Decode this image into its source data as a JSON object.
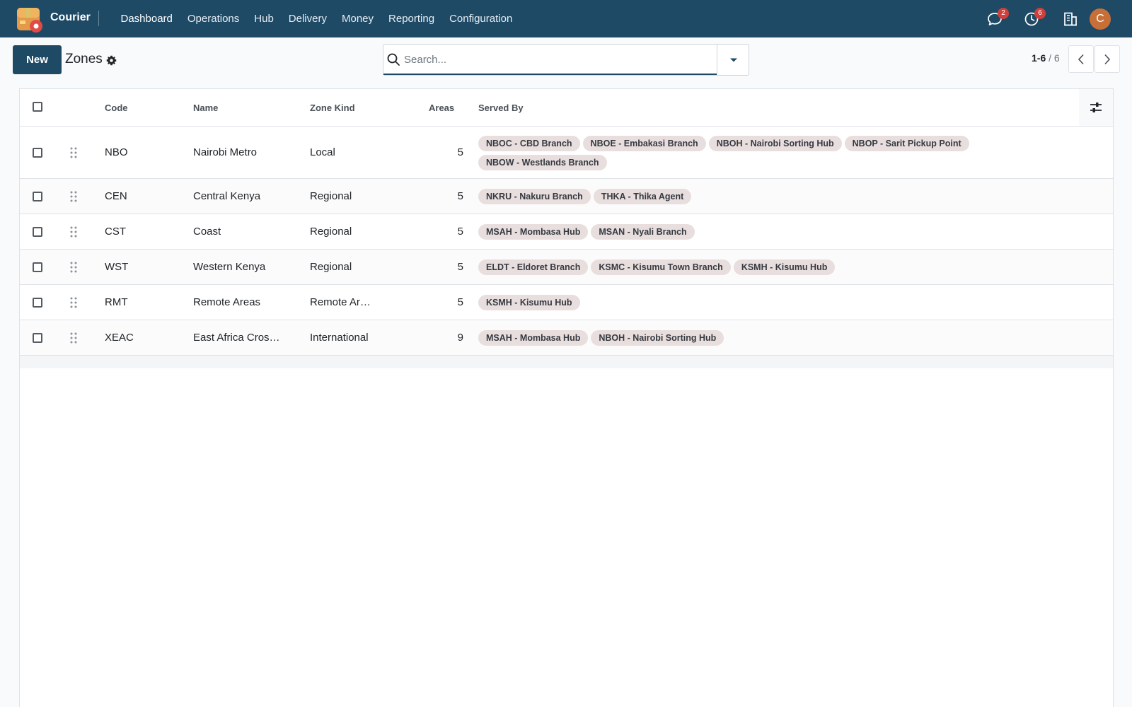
{
  "navbar": {
    "app_name": "Courier",
    "menu": [
      "Dashboard",
      "Operations",
      "Hub",
      "Delivery",
      "Money",
      "Reporting",
      "Configuration"
    ],
    "messages_count": "2",
    "activities_count": "6",
    "avatar_initial": "C"
  },
  "control": {
    "new_label": "New",
    "title": "Zones",
    "search_placeholder": "Search...",
    "pager_value": "1-6",
    "pager_sep": " / ",
    "pager_total": "6"
  },
  "table": {
    "headers": {
      "code": "Code",
      "name": "Name",
      "kind": "Zone Kind",
      "areas": "Areas",
      "served_by": "Served By"
    },
    "rows": [
      {
        "code": "NBO",
        "name": "Nairobi Metro",
        "kind": "Local",
        "areas": "5",
        "served_by": [
          "NBOC - CBD Branch",
          "NBOE - Embakasi Branch",
          "NBOH - Nairobi Sorting Hub",
          "NBOP - Sarit Pickup Point",
          "NBOW - Westlands Branch"
        ]
      },
      {
        "code": "CEN",
        "name": "Central Kenya",
        "kind": "Regional",
        "areas": "5",
        "served_by": [
          "NKRU - Nakuru Branch",
          "THKA - Thika Agent"
        ]
      },
      {
        "code": "CST",
        "name": "Coast",
        "kind": "Regional",
        "areas": "5",
        "served_by": [
          "MSAH - Mombasa Hub",
          "MSAN - Nyali Branch"
        ]
      },
      {
        "code": "WST",
        "name": "Western Kenya",
        "kind": "Regional",
        "areas": "5",
        "served_by": [
          "ELDT - Eldoret Branch",
          "KSMC - Kisumu Town Branch",
          "KSMH - Kisumu Hub"
        ]
      },
      {
        "code": "RMT",
        "name": "Remote Areas",
        "kind": "Remote Ar…",
        "areas": "5",
        "served_by": [
          "KSMH - Kisumu Hub"
        ]
      },
      {
        "code": "XEAC",
        "name": "East Africa Cros…",
        "kind": "International",
        "areas": "9",
        "served_by": [
          "MSAH - Mombasa Hub",
          "NBOH - Nairobi Sorting Hub"
        ]
      }
    ]
  },
  "colors": {
    "navbar": "#1e4a66",
    "primary": "#1e4a66",
    "tag_bg": "#e9dede",
    "badge": "#d23f3a",
    "avatar": "#c86f37"
  }
}
